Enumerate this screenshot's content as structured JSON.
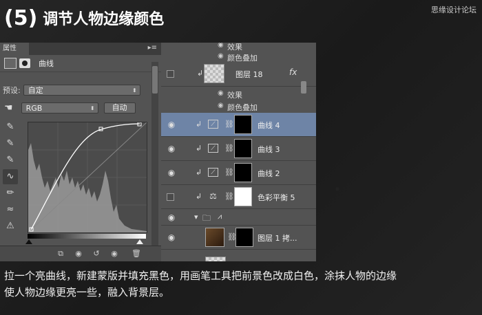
{
  "title": {
    "number": "(5)",
    "text": "调节人物边缘颜色"
  },
  "watermark": "思缘设计论坛",
  "properties": {
    "tab": "属性",
    "header_label": "曲线",
    "preset_label": "预设:",
    "preset_value": "自定",
    "channel_value": "RGB",
    "auto_button": "自动"
  },
  "layers": {
    "top_effect": "效果",
    "top_color_overlay": "颜色叠加",
    "layer18": "图层 18",
    "layer18_effect": "效果",
    "layer18_overlay": "颜色叠加",
    "fx": "fx",
    "curves4": "曲线 4",
    "curves3": "曲线 3",
    "curves2": "曲线 2",
    "color_balance": "色彩平衡 5",
    "layer1copy": "图层 1 拷..."
  },
  "caption": {
    "line1": "拉一个亮曲线，新建蒙版并填充黑色，用画笔工具把前景色改成白色，涂抹人物的边缘",
    "line2": "使人物边缘更亮一些，融入背景层。"
  }
}
